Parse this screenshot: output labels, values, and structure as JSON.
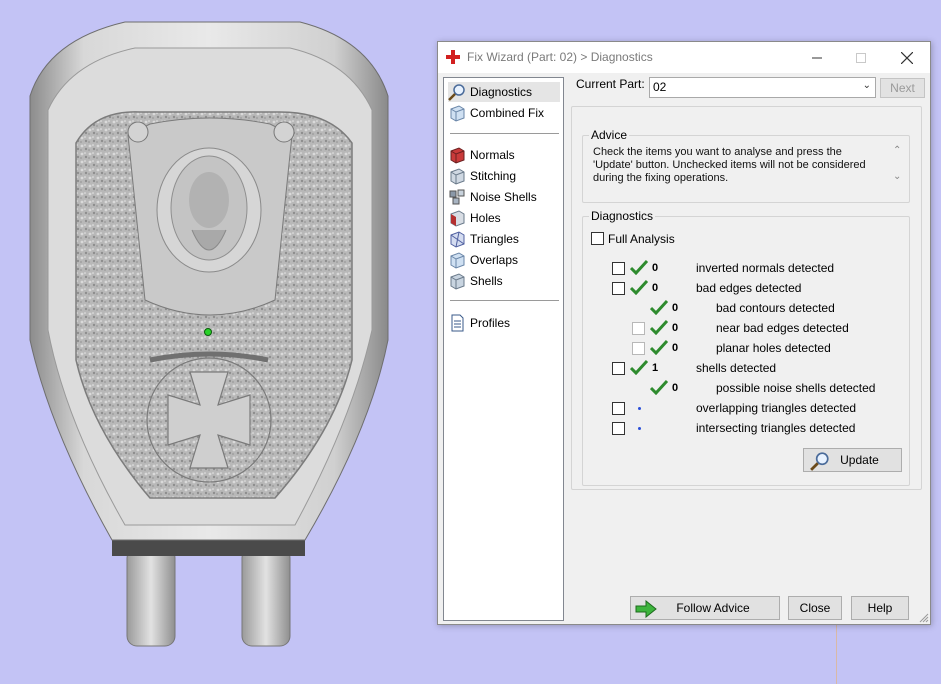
{
  "dialog": {
    "title": "Fix Wizard (Part: 02) > Diagnostics",
    "window_controls": {
      "minimize": "—",
      "maximize": "☐",
      "close": "✕"
    }
  },
  "nav": {
    "items": [
      {
        "label": "Diagnostics",
        "icon": "magnifier-icon",
        "selected": true
      },
      {
        "label": "Combined Fix",
        "icon": "cube-icon"
      },
      {
        "label": "Normals",
        "icon": "normals-cube-icon"
      },
      {
        "label": "Stitching",
        "icon": "stitching-cube-icon"
      },
      {
        "label": "Noise Shells",
        "icon": "noise-shells-icon"
      },
      {
        "label": "Holes",
        "icon": "holes-cube-icon"
      },
      {
        "label": "Triangles",
        "icon": "triangles-cube-icon"
      },
      {
        "label": "Overlaps",
        "icon": "overlaps-cube-icon"
      },
      {
        "label": "Shells",
        "icon": "shells-cube-icon"
      },
      {
        "label": "Profiles",
        "icon": "document-icon"
      }
    ]
  },
  "current_part": {
    "label": "Current Part:",
    "value": "02"
  },
  "next_label": "Next",
  "advice": {
    "legend": "Advice",
    "lines": [
      "Check the items you want to analyse and press the",
      "'Update' button. Unchecked items will not be considered",
      "during the fixing operations."
    ]
  },
  "diagnostics": {
    "legend": "Diagnostics",
    "full_analysis": "Full Analysis",
    "rows": [
      {
        "label": "inverted normals detected",
        "count": "0",
        "status": "ok"
      },
      {
        "label": "bad edges detected",
        "count": "0",
        "status": "ok"
      },
      {
        "label": "bad contours detected",
        "count": "0",
        "status": "ok"
      },
      {
        "label": "near bad edges detected",
        "count": "0",
        "status": "ok"
      },
      {
        "label": "planar holes detected",
        "count": "0",
        "status": "ok"
      },
      {
        "label": "shells detected",
        "count": "1",
        "status": "ok"
      },
      {
        "label": "possible noise shells detected",
        "count": "0",
        "status": "ok"
      },
      {
        "label": "overlapping triangles detected",
        "count": "",
        "status": "pending"
      },
      {
        "label": "intersecting triangles detected",
        "count": "",
        "status": "pending"
      }
    ],
    "update_label": "Update"
  },
  "footer": {
    "follow_advice": "Follow Advice",
    "close": "Close",
    "help": "Help"
  },
  "colors": {
    "viewport_background": "#c3c3f5",
    "check_green": "#2e8b2e",
    "pending_dot": "#2b4fd8"
  }
}
